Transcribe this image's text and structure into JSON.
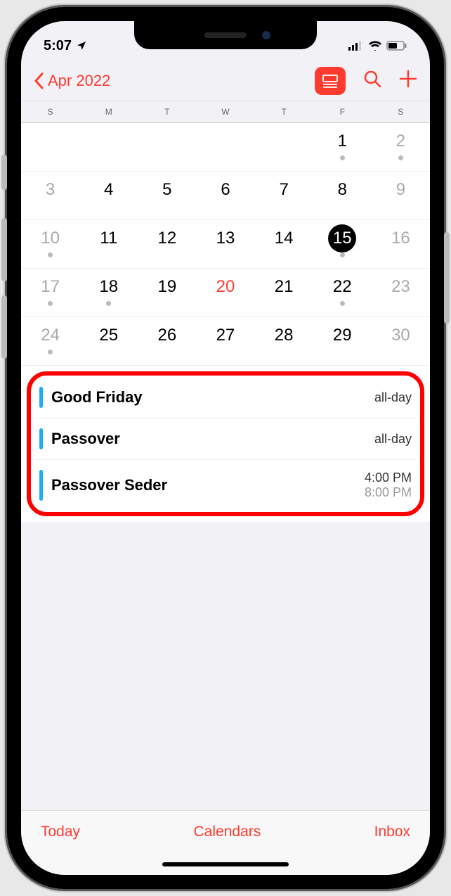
{
  "status": {
    "time": "5:07",
    "location_arrow": true
  },
  "nav": {
    "month_label": "Apr 2022"
  },
  "colors": {
    "accent": "#ff3b30",
    "event_bar": "#1badf8"
  },
  "weekdays": [
    "S",
    "M",
    "T",
    "W",
    "T",
    "F",
    "S"
  ],
  "selected_day": 15,
  "today_day": 20,
  "weeks": [
    [
      {
        "n": "",
        "dot": false
      },
      {
        "n": "",
        "dot": false
      },
      {
        "n": "",
        "dot": false
      },
      {
        "n": "",
        "dot": false
      },
      {
        "n": "",
        "dot": false
      },
      {
        "n": "1",
        "dot": true
      },
      {
        "n": "2",
        "dot": true,
        "weekend": true
      }
    ],
    [
      {
        "n": "3",
        "weekend": true
      },
      {
        "n": "4"
      },
      {
        "n": "5"
      },
      {
        "n": "6"
      },
      {
        "n": "7"
      },
      {
        "n": "8"
      },
      {
        "n": "9",
        "weekend": true
      }
    ],
    [
      {
        "n": "10",
        "dot": true,
        "weekend": true
      },
      {
        "n": "11"
      },
      {
        "n": "12"
      },
      {
        "n": "13"
      },
      {
        "n": "14"
      },
      {
        "n": "15",
        "dot": true,
        "selected": true
      },
      {
        "n": "16",
        "weekend": true
      }
    ],
    [
      {
        "n": "17",
        "dot": true,
        "weekend": true
      },
      {
        "n": "18",
        "dot": true
      },
      {
        "n": "19"
      },
      {
        "n": "20",
        "today": true
      },
      {
        "n": "21"
      },
      {
        "n": "22",
        "dot": true
      },
      {
        "n": "23",
        "weekend": true
      }
    ],
    [
      {
        "n": "24",
        "dot": true,
        "weekend": true
      },
      {
        "n": "25"
      },
      {
        "n": "26"
      },
      {
        "n": "27"
      },
      {
        "n": "28"
      },
      {
        "n": "29"
      },
      {
        "n": "30",
        "weekend": true
      }
    ]
  ],
  "events": [
    {
      "title": "Good Friday",
      "time": "all-day",
      "sub": ""
    },
    {
      "title": "Passover",
      "time": "all-day",
      "sub": ""
    },
    {
      "title": "Passover Seder",
      "time": "4:00 PM",
      "sub": "8:00 PM"
    }
  ],
  "bottom": {
    "today": "Today",
    "calendars": "Calendars",
    "inbox": "Inbox"
  }
}
